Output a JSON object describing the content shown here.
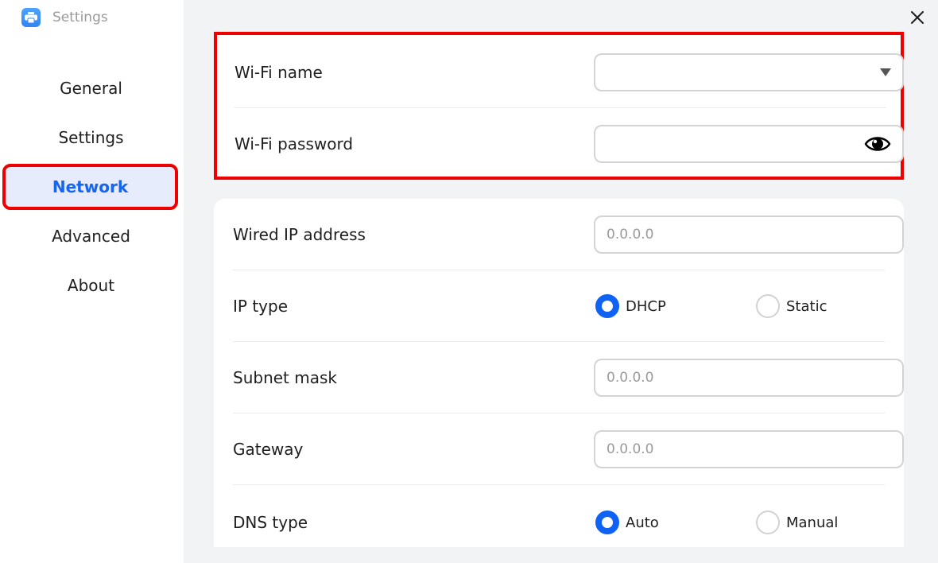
{
  "window": {
    "title": "Settings",
    "icons": {
      "app": "printer-icon",
      "close": "close-icon"
    }
  },
  "sidebar": {
    "items": [
      {
        "label": "General",
        "active": false
      },
      {
        "label": "Settings",
        "active": false
      },
      {
        "label": "Network",
        "active": true
      },
      {
        "label": "Advanced",
        "active": false
      },
      {
        "label": "About",
        "active": false
      }
    ]
  },
  "wifi": {
    "name_label": "Wi-Fi name",
    "name_value": "",
    "name_icon": "dropdown-arrow-icon",
    "password_label": "Wi-Fi password",
    "password_value": "",
    "password_icon": "eye-icon"
  },
  "wired": {
    "ip_label": "Wired IP address",
    "ip_placeholder": "0.0.0.0",
    "ip_type_label": "IP type",
    "ip_type_options": [
      {
        "label": "DHCP",
        "checked": true
      },
      {
        "label": "Static",
        "checked": false
      }
    ],
    "subnet_label": "Subnet mask",
    "subnet_placeholder": "0.0.0.0",
    "gateway_label": "Gateway",
    "gateway_placeholder": "0.0.0.0",
    "dns_type_label": "DNS type",
    "dns_type_options": [
      {
        "label": "Auto",
        "checked": true
      },
      {
        "label": "Manual",
        "checked": false
      }
    ]
  },
  "colors": {
    "accent": "#1062f5",
    "highlight_outline": "#ee0000",
    "nav_active_bg": "#e6ecfb"
  }
}
